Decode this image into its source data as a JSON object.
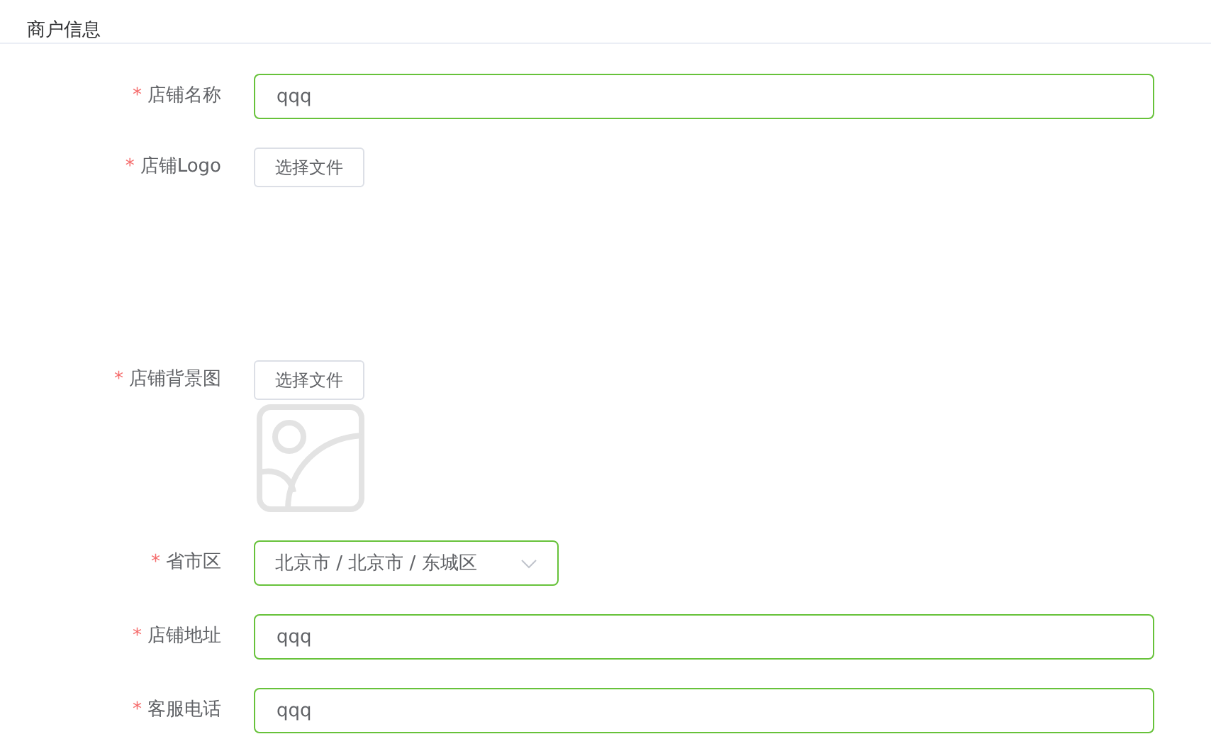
{
  "header": {
    "title": "商户信息"
  },
  "fields": [
    {
      "kind": "text",
      "required_mark": "*",
      "label": "店铺名称",
      "value": "qqq"
    },
    {
      "kind": "file",
      "required_mark": "*",
      "label": "店铺Logo",
      "button": "选择文件",
      "image_shown": false
    },
    {
      "kind": "file",
      "required_mark": "*",
      "label": "店铺背景图",
      "button": "选择文件",
      "image_shown": true
    },
    {
      "kind": "select",
      "required_mark": "*",
      "label": "省市区",
      "value": "北京市 / 北京市 / 东城区"
    },
    {
      "kind": "text",
      "required_mark": "*",
      "label": "店铺地址",
      "value": "qqq"
    },
    {
      "kind": "text",
      "required_mark": "*",
      "label": "客服电话",
      "value": "qqq"
    }
  ]
}
